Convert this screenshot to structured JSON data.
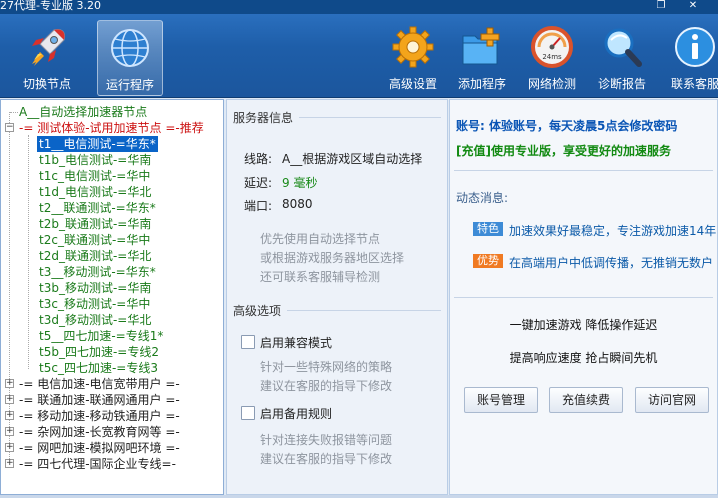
{
  "window": {
    "title": "27代理-专业版 3.20",
    "controls": [
      "restore-icon",
      "close-icon"
    ]
  },
  "toolbar": {
    "items": [
      {
        "label": "切换节点",
        "icon": "rocket-icon",
        "active": false
      },
      {
        "label": "运行程序",
        "icon": "globe-icon",
        "active": true
      },
      {
        "label": "高级设置",
        "icon": "gear-icon",
        "active": false
      },
      {
        "label": "添加程序",
        "icon": "add-folder-icon",
        "active": false
      },
      {
        "label": "网络检测",
        "icon": "speedometer-icon",
        "active": false
      },
      {
        "label": "诊断报告",
        "icon": "magnifier-icon",
        "active": false
      },
      {
        "label": "联系客服",
        "icon": "info-icon",
        "active": false
      }
    ],
    "speedometer_text": "24ms"
  },
  "tree": {
    "nodes": [
      {
        "text": "A__自动选择加速器节点",
        "color": "#1a7a1a",
        "level": 0
      },
      {
        "text": "-= 测试体验-试用加速节点 =-推荐",
        "color": "#cc1111",
        "level": 0,
        "expander": "-"
      },
      {
        "text": "t1__电信测试-=华东*",
        "color": "#1a7a1a",
        "level": 1,
        "selected": true
      },
      {
        "text": "t1b_电信测试-=华南",
        "color": "#1a7a1a",
        "level": 1
      },
      {
        "text": "t1c_电信测试-=华中",
        "color": "#1a7a1a",
        "level": 1
      },
      {
        "text": "t1d_电信测试-=华北",
        "color": "#1a7a1a",
        "level": 1
      },
      {
        "text": "t2__联通测试-=华东*",
        "color": "#1a7a1a",
        "level": 1
      },
      {
        "text": "t2b_联通测试-=华南",
        "color": "#1a7a1a",
        "level": 1
      },
      {
        "text": "t2c_联通测试-=华中",
        "color": "#1a7a1a",
        "level": 1
      },
      {
        "text": "t2d_联通测试-=华北",
        "color": "#1a7a1a",
        "level": 1
      },
      {
        "text": "t3__移动测试-=华东*",
        "color": "#1a7a1a",
        "level": 1
      },
      {
        "text": "t3b_移动测试-=华南",
        "color": "#1a7a1a",
        "level": 1
      },
      {
        "text": "t3c_移动测试-=华中",
        "color": "#1a7a1a",
        "level": 1
      },
      {
        "text": "t3d_移动测试-=华北",
        "color": "#1a7a1a",
        "level": 1
      },
      {
        "text": "t5__四七加速-=专线1*",
        "color": "#1a7a1a",
        "level": 1
      },
      {
        "text": "t5b_四七加速-=专线2",
        "color": "#1a7a1a",
        "level": 1
      },
      {
        "text": "t5c_四七加速-=专线3",
        "color": "#1a7a1a",
        "level": 1
      },
      {
        "text": "-= 电信加速-电信宽带用户 =-",
        "color": "#111111",
        "level": 0,
        "expander": "+"
      },
      {
        "text": "-= 联通加速-联通网通用户 =-",
        "color": "#111111",
        "level": 0,
        "expander": "+"
      },
      {
        "text": "-= 移动加速-移动铁通用户 =-",
        "color": "#111111",
        "level": 0,
        "expander": "+"
      },
      {
        "text": "-= 杂网加速-长宽教育网等 =-",
        "color": "#111111",
        "level": 0,
        "expander": "+"
      },
      {
        "text": "-= 网吧加速-模拟网吧环境 =-",
        "color": "#111111",
        "level": 0,
        "expander": "+"
      },
      {
        "text": "-= 四七代理-国际企业专线=-",
        "color": "#111111",
        "level": 0,
        "expander": "+"
      }
    ]
  },
  "server_info": {
    "section_title": "服务器信息",
    "route_label": "线路:",
    "route_value": "A__根据游戏区域自动选择",
    "latency_label": "延迟:",
    "latency_value": "9 毫秒",
    "port_label": "端口:",
    "port_value": "8080",
    "hints": [
      "优先使用自动选择节点",
      "或根据游戏服务器地区选择",
      "还可联系客服辅导检测"
    ]
  },
  "advanced": {
    "section_title": "高级选项",
    "compat_label": "启用兼容模式",
    "compat_hints": [
      "针对一些特殊网络的策略",
      "建议在客服的指导下修改"
    ],
    "backup_label": "启用备用规则",
    "backup_hints": [
      "针对连接失败报错等问题",
      "建议在客服的指导下修改"
    ]
  },
  "account": {
    "line1": "账号: 体验账号，每天凌晨5点会修改密码",
    "line2": "[充值]使用专业版，享受更好的加速服务",
    "line1_color": "#0a55b5",
    "line2_color": "#128a12"
  },
  "news": {
    "title": "动态消息:",
    "items": [
      {
        "badge": "特色",
        "badge_color": "#3d8bd6",
        "text": "加速效果好最稳定，专注游戏加速14年"
      },
      {
        "badge": "优势",
        "badge_color": "#f07a22",
        "text": "在高端用户中低调传播，无推销无数户"
      }
    ]
  },
  "slogan": {
    "line1": "一键加速游戏 降低操作延迟",
    "line2": "提高响应速度 抢占瞬间先机"
  },
  "buttons": {
    "account_manage": "账号管理",
    "recharge": "充值续费",
    "official_site": "访问官网"
  }
}
